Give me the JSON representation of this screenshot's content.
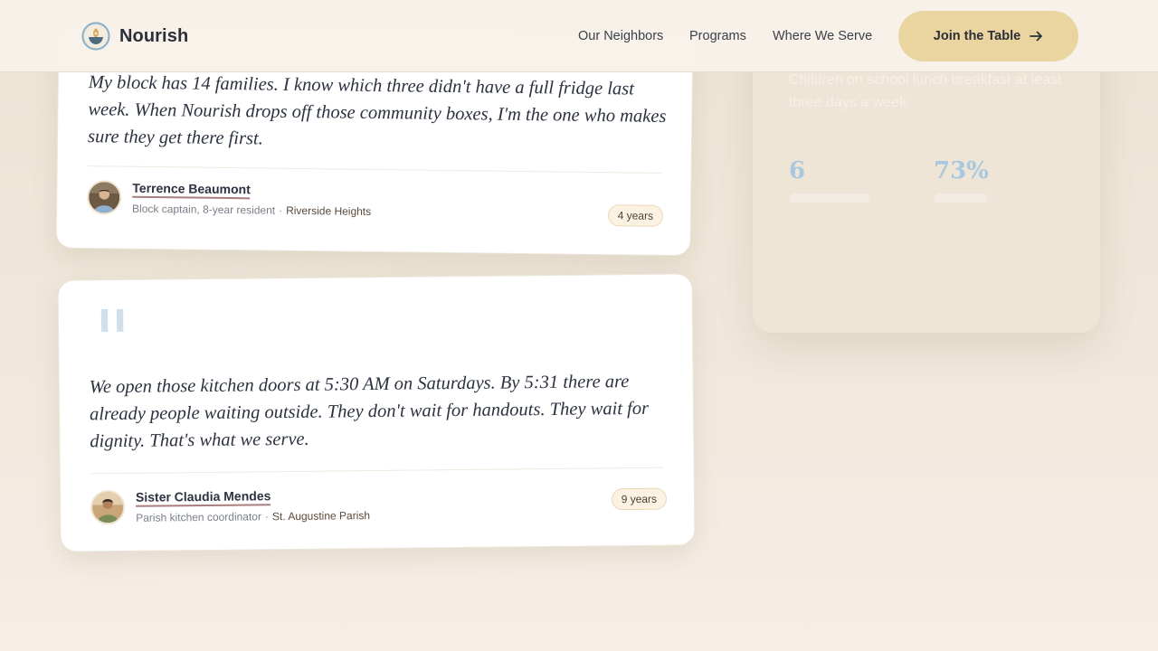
{
  "header": {
    "brand": "Nourish",
    "nav": [
      "Our Neighbors",
      "Programs",
      "Where We Serve"
    ],
    "cta_label": "Join the Table",
    "cta_icon": "arrow-right-icon"
  },
  "stats": {
    "faded_text": "Children on school lunch breakfast at least three days a week",
    "values": [
      "6",
      "73%"
    ]
  },
  "testimonials": [
    {
      "quote": "My block has 14 families. I know which three didn't have a full fridge last week. When Nourish drops off those community boxes, I'm the one who makes sure they get there first.",
      "name": "Terrence Beaumont",
      "role": "Block captain, 8-year resident",
      "separator": "·",
      "place": "Riverside Heights",
      "tenure": "4 years"
    },
    {
      "quote_mark": "\"",
      "quote": "We open those kitchen doors at 5:30 AM on Saturdays. By 5:31 there are already people waiting outside. They don't wait for handouts. They wait for dignity. That's what we serve.",
      "name": "Sister Claudia Mendes",
      "role": "Parish kitchen coordinator",
      "separator": "·",
      "place": "St. Augustine Parish",
      "tenure": "9 years"
    }
  ],
  "colors": {
    "cta_bg": "#ead4a0",
    "stat_number": "#a8c8df",
    "quote_mark": "#cfe0ec",
    "name_underline": "#a87e7e"
  }
}
